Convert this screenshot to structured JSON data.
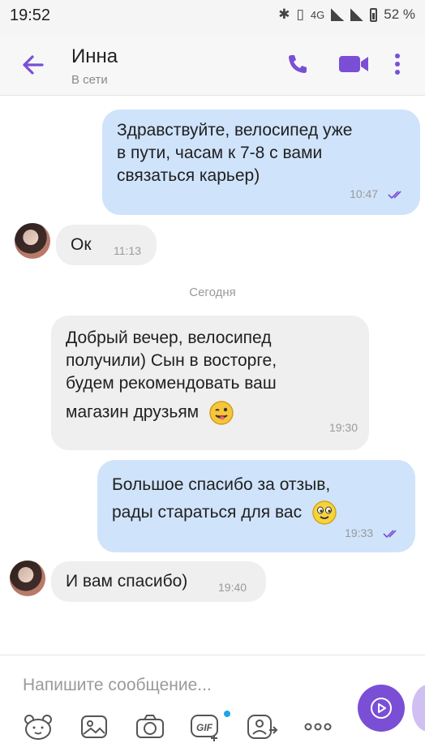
{
  "statusbar": {
    "time": "19:52",
    "network": "4G",
    "battery": "52 %"
  },
  "header": {
    "contact_name": "Инна",
    "status": "В сети"
  },
  "messages": [
    {
      "direction": "out",
      "text_lines": [
        "Здравствуйте, велосипед уже",
        "в пути, часам к 7-8 с вами",
        "связаться карьер)"
      ],
      "time": "10:47"
    },
    {
      "direction": "in",
      "text_lines": [
        "Ок"
      ],
      "time": "11:13"
    },
    {
      "direction": "in",
      "text_lines": [
        "Добрый вечер, велосипед",
        "получили) Сын в восторге,",
        "будем рекомендовать ваш",
        "магазин друзьям"
      ],
      "time": "19:30",
      "emoji": "wink"
    },
    {
      "direction": "out",
      "text_lines": [
        "Большое спасибо за отзыв,",
        "рады стараться для вас"
      ],
      "time": "19:33",
      "emoji": "smile"
    },
    {
      "direction": "in",
      "text_lines": [
        "И вам спасибо)"
      ],
      "time": "19:40"
    }
  ],
  "date_separator": "Сегодня",
  "composer": {
    "placeholder": "Напишите сообщение..."
  },
  "colors": {
    "accent": "#7a4fd6",
    "outgoing_bubble": "#cfe3fb",
    "incoming_bubble": "#efefef"
  },
  "icons": {
    "back": "arrow-left-icon",
    "call": "phone-icon",
    "video": "video-camera-icon",
    "more": "more-vertical-icon"
  }
}
